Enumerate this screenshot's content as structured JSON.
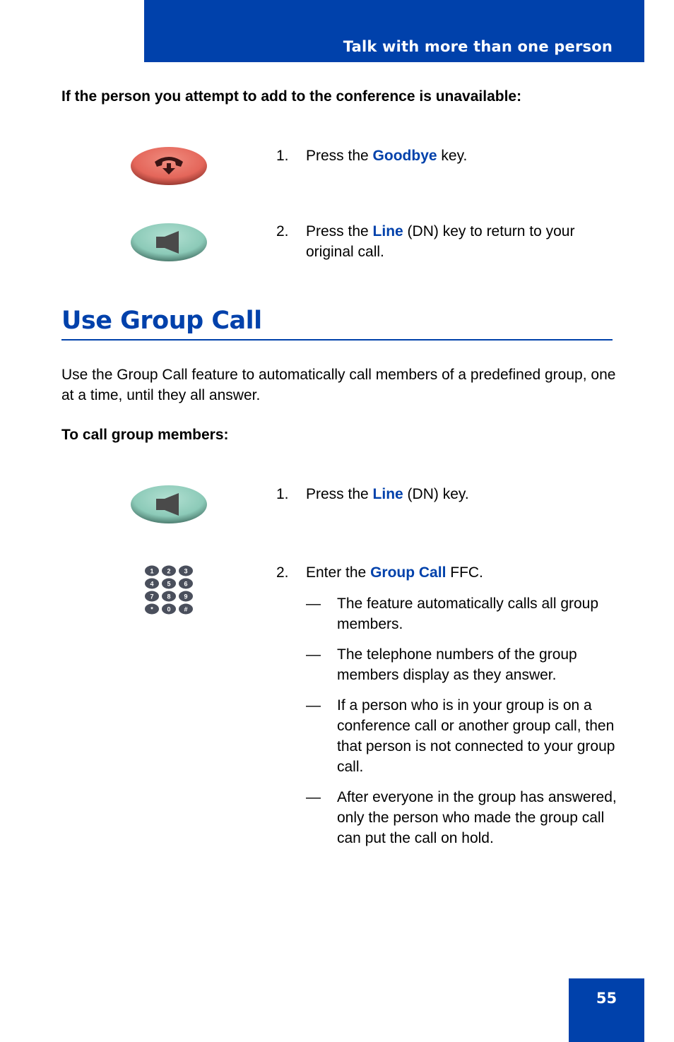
{
  "header": {
    "title": "Talk with more than one person"
  },
  "unavailable_section": {
    "heading": "If the person you attempt to add to the conference is unavailable:",
    "steps": [
      {
        "number": "1.",
        "prefix": "Press the ",
        "keyword": "Goodbye",
        "suffix": " key.",
        "icon": "goodbye-key-icon"
      },
      {
        "number": "2.",
        "prefix": "Press the ",
        "keyword": "Line",
        "suffix": " (DN) key to return to your original call.",
        "icon": "line-key-icon"
      }
    ]
  },
  "group_call_section": {
    "title": "Use Group Call",
    "description": "Use the Group Call feature to automatically call members of a predefined group, one at a time, until they all answer.",
    "subheading": "To call group members:",
    "steps": [
      {
        "number": "1.",
        "prefix": "Press the ",
        "keyword": "Line",
        "suffix": " (DN) key.",
        "icon": "line-key-icon"
      },
      {
        "number": "2.",
        "prefix": "Enter the ",
        "keyword": "Group Call",
        "suffix": " FFC.",
        "icon": "dialpad-icon"
      }
    ],
    "notes": [
      {
        "dash": "—",
        "text": "The feature automatically calls all group members."
      },
      {
        "dash": "—",
        "text": "The telephone numbers of the group members display as they answer."
      },
      {
        "dash": "—",
        "text": "If a person who is in your group is on a conference call or another group call, then that person is not connected to your group call."
      },
      {
        "dash": "—",
        "text": "After everyone in the group has answered, only the person who made the group call can put the call on hold."
      }
    ]
  },
  "dialpad": {
    "keys": [
      "1",
      "2",
      "3",
      "4",
      "5",
      "6",
      "7",
      "8",
      "9",
      "*",
      "0",
      "#"
    ]
  },
  "footer": {
    "page_number": "55"
  },
  "colors": {
    "brand_blue": "#0041ab",
    "goodbye_key": "#e8675a",
    "line_key": "#8ccab8",
    "dialpad_key": "#4a4f5c"
  }
}
